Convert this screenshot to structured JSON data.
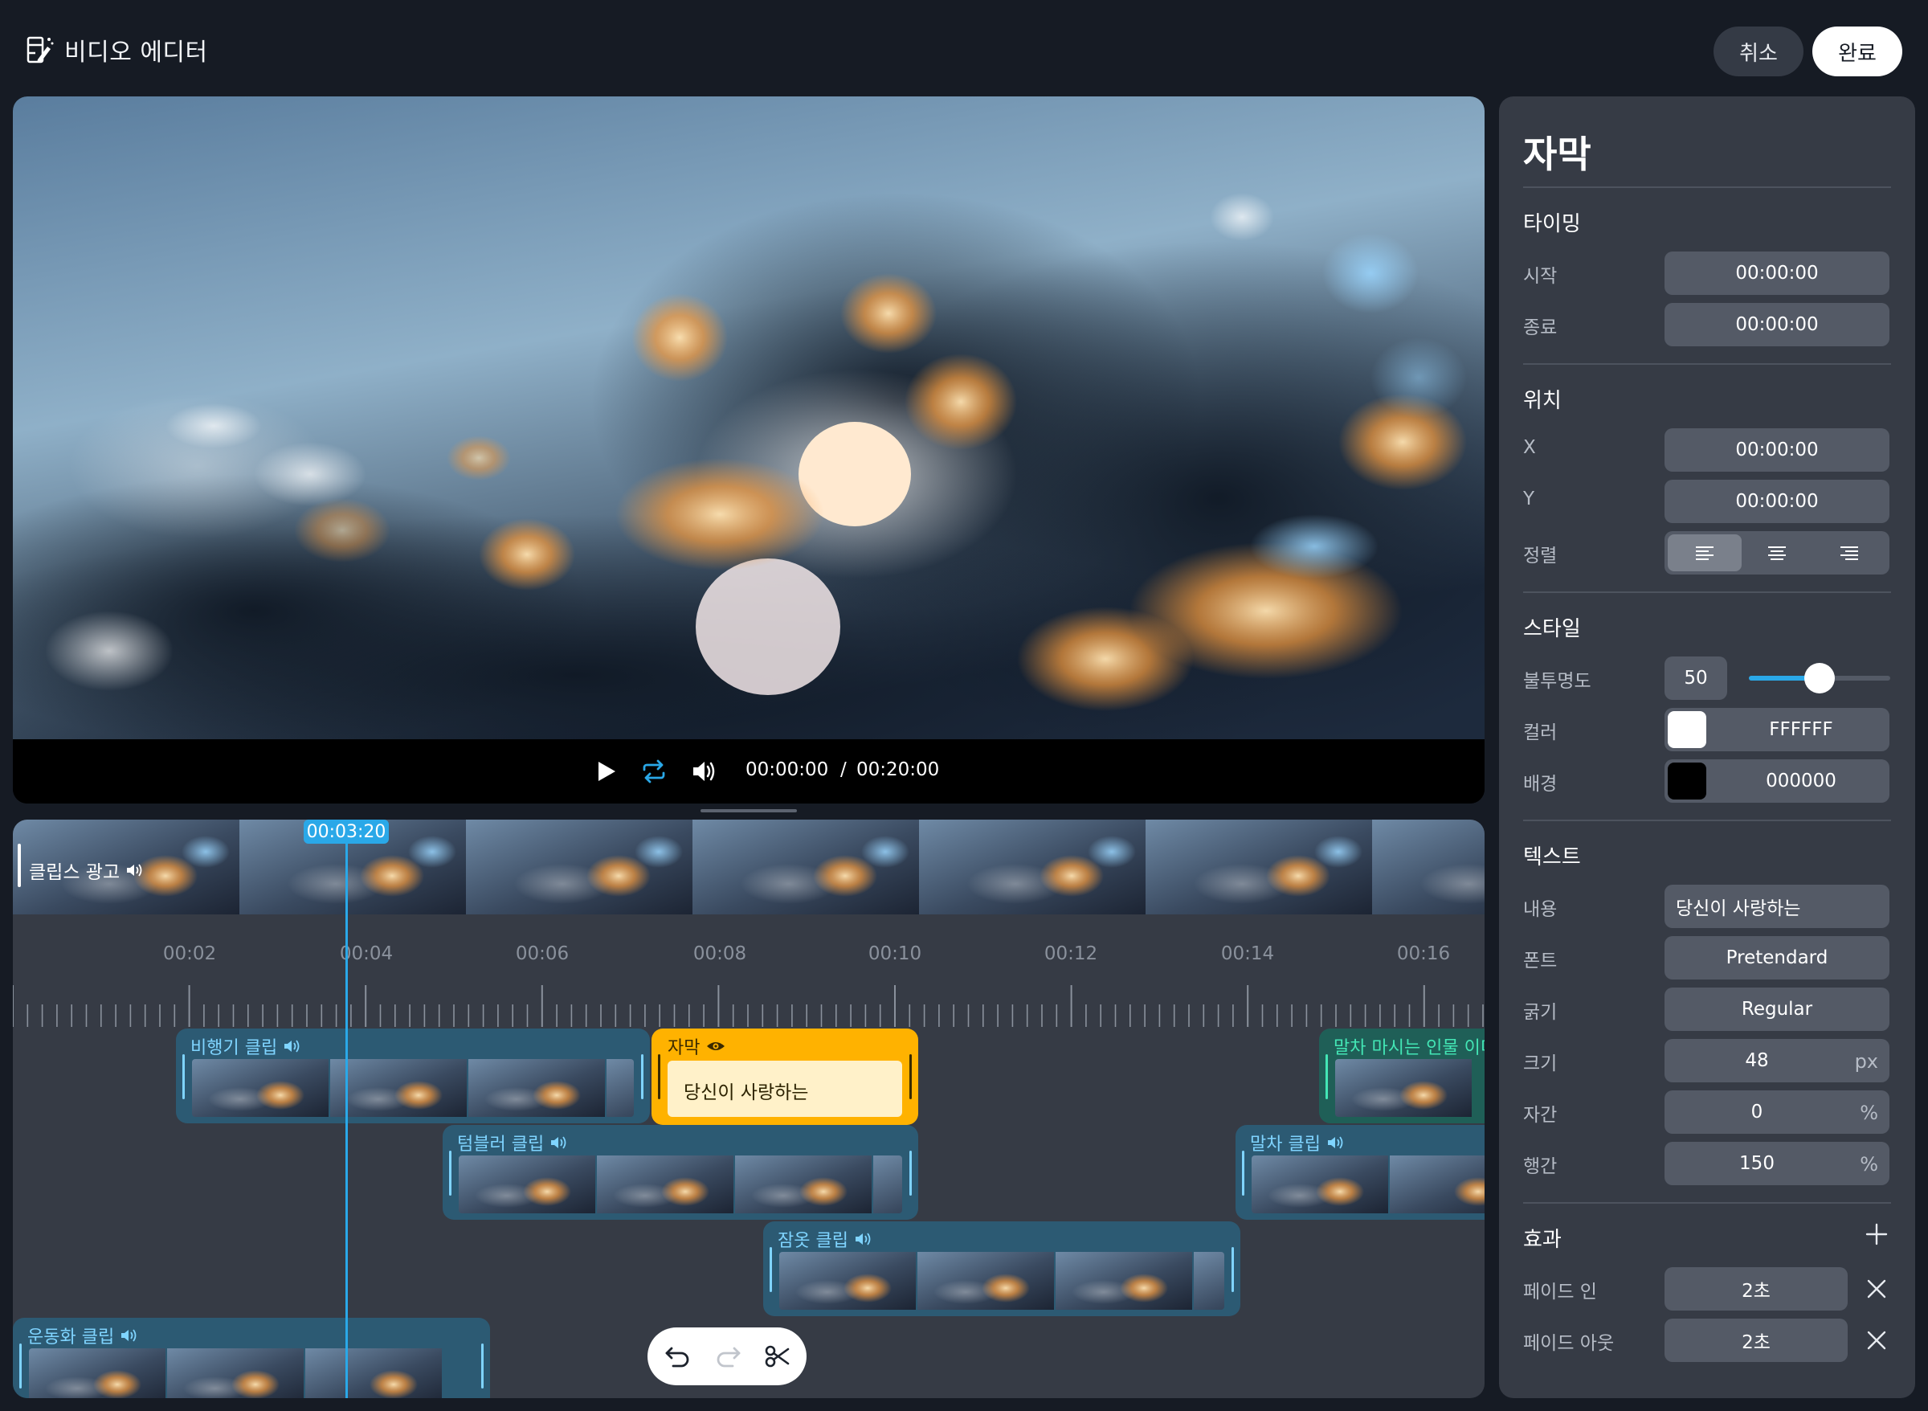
{
  "header": {
    "title": "비디오 에디터",
    "cancel_label": "취소",
    "done_label": "완료"
  },
  "player": {
    "current_time": "00:00:00",
    "separator": "/",
    "total_time": "00:20:00"
  },
  "timeline": {
    "playhead_time": "00:03:20",
    "strip_label": "클립스 광고",
    "ticks": [
      "00:02",
      "00:04",
      "00:06",
      "00:08",
      "00:10",
      "00:12",
      "00:14",
      "00:16"
    ],
    "clips": {
      "airplane": "비행기 클립",
      "tumbler": "텀블러 클립",
      "pajamas": "잠옷 클립",
      "sneakers": "운동화 클립",
      "matcha": "말차 클립",
      "matcha_person": "말차 마시는 인물 이미"
    },
    "caption_clip": {
      "label": "자막",
      "text": "당신이 사랑하는"
    }
  },
  "panel": {
    "title": "자막",
    "timing": {
      "title": "타이밍",
      "start_label": "시작",
      "start_value": "00:00:00",
      "end_label": "종료",
      "end_value": "00:00:00"
    },
    "position": {
      "title": "위치",
      "x_label": "X",
      "x_value": "00:00:00",
      "y_label": "Y",
      "y_value": "00:00:00",
      "align_label": "정렬",
      "align_selected": "left"
    },
    "style": {
      "title": "스타일",
      "opacity_label": "불투명도",
      "opacity_value": "50",
      "opacity_fraction": 0.5,
      "color_label": "컬러",
      "color_hex": "FFFFFF",
      "color_swatch": "#ffffff",
      "bg_label": "배경",
      "bg_hex": "000000",
      "bg_swatch": "#000000"
    },
    "text": {
      "title": "텍스트",
      "content_label": "내용",
      "content_value": "당신이 사랑하는",
      "font_label": "폰트",
      "font_value": "Pretendard",
      "weight_label": "굵기",
      "weight_value": "Regular",
      "size_label": "크기",
      "size_value": "48",
      "size_unit": "px",
      "tracking_label": "자간",
      "tracking_value": "0",
      "tracking_unit": "%",
      "leading_label": "행간",
      "leading_value": "150",
      "leading_unit": "%"
    },
    "effects": {
      "title": "효과",
      "fade_in_label": "페이드 인",
      "fade_in_value": "2초",
      "fade_out_label": "페이드 아웃",
      "fade_out_value": "2초"
    }
  },
  "colors": {
    "accent": "#2aa8e8",
    "caption": "#ffb200",
    "clip": "#2c5a73",
    "clip_green": "#1f5f57"
  }
}
